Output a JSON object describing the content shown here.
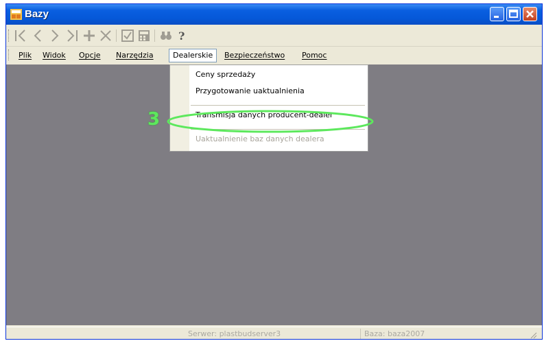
{
  "window": {
    "title": "Bazy"
  },
  "menu": {
    "items": [
      "Plik",
      "Widok",
      "Opcje",
      "Narzędzia",
      "Dealerskie",
      "Bezpieczeństwo",
      "Pomoc"
    ]
  },
  "dropdown": {
    "items": [
      {
        "label": "Ceny sprzedaży",
        "enabled": true
      },
      {
        "label": "Przygotowanie uaktualnienia",
        "enabled": true
      },
      {
        "label": "Transmisja danych producent-dealer",
        "enabled": true
      },
      {
        "label": "Uaktualnienie baz danych dealera",
        "enabled": false
      }
    ]
  },
  "annotation": {
    "number": "3",
    "color": "#5de85d"
  },
  "status": {
    "server": "Serwer: plastbudserver3",
    "baza": "Baza: baza2007"
  },
  "toolbar": {
    "icons": [
      "first-record-icon",
      "previous-record-icon",
      "next-record-icon",
      "last-record-icon",
      "add-record-icon",
      "delete-record-icon",
      "confirm-icon",
      "calculator-icon",
      "binoculars-search-icon",
      "help-icon"
    ]
  },
  "colors": {
    "titlebar": "#0558d8",
    "client_area": "#7f7d83",
    "highlight": "#5de85d"
  }
}
